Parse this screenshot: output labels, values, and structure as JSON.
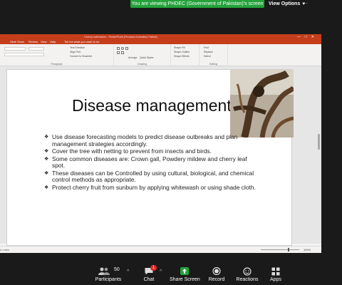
{
  "banner": {
    "share_text": "You are viewing PHDEC (Government of Pakistan)'s screen",
    "view_options": "View Options"
  },
  "ppt": {
    "doc_title": "Cherry cultivation - PowerPoint (Product Activation Failed)",
    "tabs": [
      "Slide Show",
      "Review",
      "View",
      "Help"
    ],
    "ribbon": {
      "tell_me": "Tell me what you want to do",
      "text_direction": "Text Direction",
      "align_text": "Align Text",
      "convert_smartart": "Convert to SmartArt",
      "arrange": "Arrange",
      "quick_styles": "Quick Styles",
      "shape_fill": "Shape Fill",
      "shape_outline": "Shape Outline",
      "shape_effects": "Shape Effects",
      "find": "Find",
      "replace": "Replace",
      "select": "Select",
      "group_paragraph": "Paragraph",
      "group_drawing": "Drawing",
      "group_editing": "Editing"
    },
    "slide": {
      "title": "Disease management",
      "bullets": [
        "Use disease forecasting models to predict disease outbreaks and plan management strategies accordingly.",
        "Cover the tree with netting to prevent from insects and birds.",
        "Some common diseases are: Crown gall, Powdery mildew and cherry leaf spot.",
        "These diseases can be Controlled by using cultural, biological, and chemical control methods as appropriate.",
        "Protect cherry fruit from sunburn by applying whitewash or using shade cloth."
      ]
    },
    "status": {
      "notes": "d notes",
      "zoom": "100%"
    }
  },
  "toolbar": {
    "participants_label": "Participants",
    "participants_count": "50",
    "chat_label": "Chat",
    "chat_badge": "1",
    "share_label": "Share Screen",
    "record_label": "Record",
    "reactions_label": "Reactions",
    "apps_label": "Apps"
  },
  "colors": {
    "ppt_accent": "#c43e1c",
    "zoom_banner": "#23a23a",
    "share_green": "#23a23a",
    "badge_red": "#e02828"
  }
}
